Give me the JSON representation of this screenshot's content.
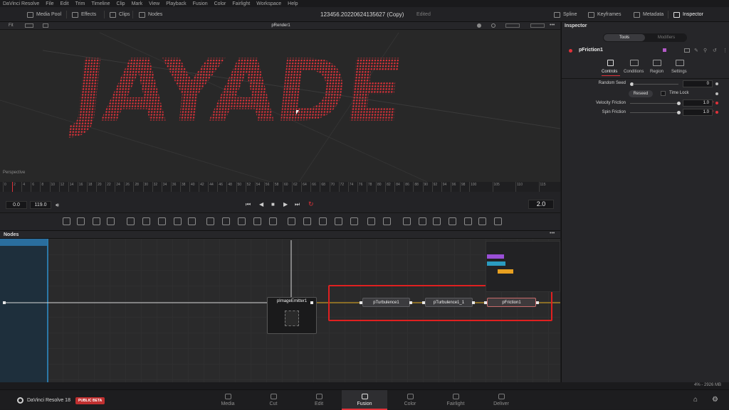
{
  "menubar": {
    "items": [
      "DaVinci Resolve",
      "File",
      "Edit",
      "Trim",
      "Timeline",
      "Clip",
      "Mark",
      "View",
      "Playback",
      "Fusion",
      "Color",
      "Fairlight",
      "Workspace",
      "Help"
    ]
  },
  "toolbar": {
    "media_pool": "Media Pool",
    "effects": "Effects",
    "clips": "Clips",
    "nodes": "Nodes",
    "project_title": "123456.20220624135627 (Copy)",
    "edited": "Edited",
    "spline": "Spline",
    "keyframes": "Keyframes",
    "metadata": "Metadata",
    "inspector": "Inspector"
  },
  "viewer": {
    "fit": "Fit",
    "render_node": "pRender1",
    "view_mode": "Perspective",
    "letters": "JAYADE"
  },
  "timeline": {
    "ticks": [
      "0",
      "2",
      "4",
      "6",
      "8",
      "10",
      "12",
      "14",
      "16",
      "18",
      "20",
      "22",
      "24",
      "26",
      "28",
      "30",
      "32",
      "34",
      "36",
      "38",
      "40",
      "42",
      "44",
      "46",
      "48",
      "50",
      "52",
      "54",
      "56",
      "58",
      "60",
      "62",
      "64",
      "66",
      "68",
      "70",
      "72",
      "74",
      "76",
      "78",
      "80",
      "82",
      "84",
      "86",
      "88",
      "90",
      "92",
      "94",
      "96",
      "98",
      "100",
      "105",
      "110",
      "115"
    ]
  },
  "transport": {
    "start": "0.0",
    "end": "119.0",
    "current": "2.0"
  },
  "nodes_panel": {
    "title": "Nodes",
    "nodes": {
      "emitter": "pImageEmitter1",
      "turb1": "pTurbulence1",
      "turb2": "pTurbulence1_1",
      "friction": "pFriction1"
    }
  },
  "inspector": {
    "title": "Inspector",
    "tab_tools": "Tools",
    "tab_modifiers": "Modifiers",
    "node_name": "pFriction1",
    "subtabs": [
      "Controls",
      "Conditions",
      "Region",
      "Settings"
    ],
    "random_seed_label": "Random Seed",
    "random_seed_value": "0",
    "reseed": "Reseed",
    "time_lock": "Time Lock",
    "velocity_label": "Velocity Friction",
    "velocity_value": "1.0",
    "spin_label": "Spin Friction",
    "spin_value": "1.0"
  },
  "status": {
    "memory": "4% - 2926 MB"
  },
  "pagebar": {
    "app": "DaVinci Resolve 18",
    "badge": "PUBLIC BETA",
    "pages": [
      "Media",
      "Cut",
      "Edit",
      "Fusion",
      "Color",
      "Fairlight",
      "Deliver"
    ],
    "active": "Fusion"
  },
  "colors": {
    "accent_red": "#e0323a",
    "highlight_box": "#e02020"
  }
}
